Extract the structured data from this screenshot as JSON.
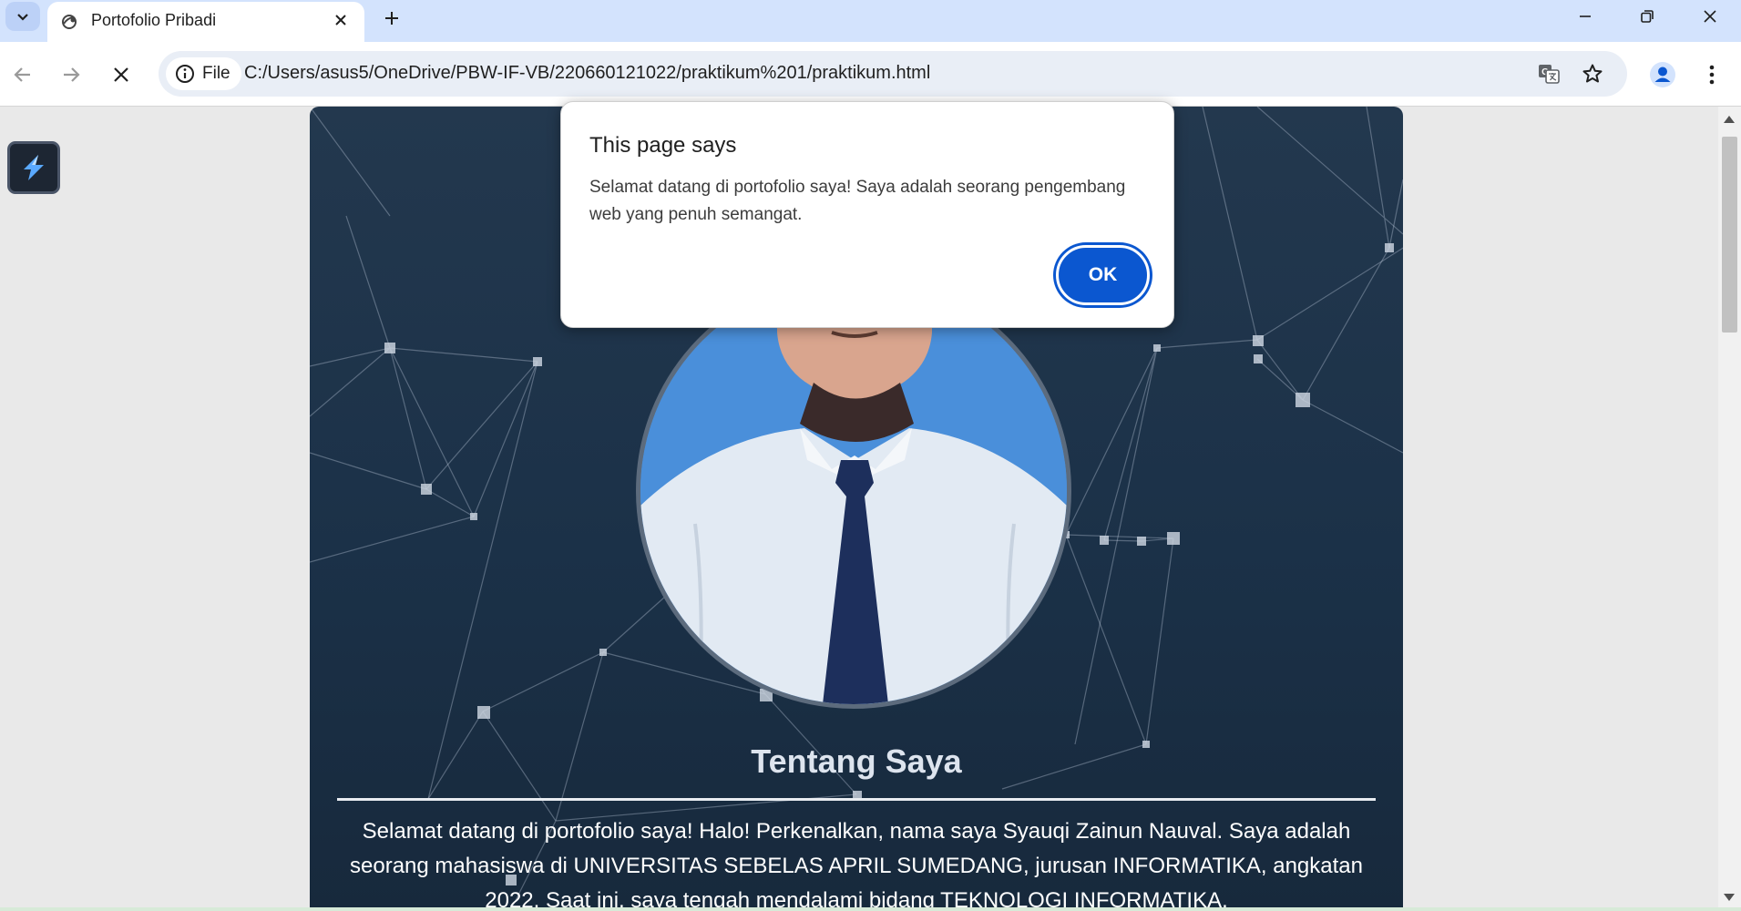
{
  "browser": {
    "tab": {
      "title": "Portofolio Pribadi"
    },
    "address_bar": {
      "chip_label": "File",
      "url": "C:/Users/asus5/OneDrive/PBW-IF-VB/220660121022/praktikum%201/praktikum.html"
    },
    "icons": {
      "tab_search": "chevron-down-icon",
      "favicon": "globe-icon",
      "close_tab": "close-icon",
      "new_tab": "plus-icon",
      "minimize": "minimize-icon",
      "restore": "restore-icon",
      "close_window": "close-icon",
      "back": "back-arrow-icon",
      "forward": "forward-arrow-icon",
      "stop": "stop-icon",
      "site_info": "info-icon",
      "translate": "translate-icon",
      "bookmark": "star-icon",
      "profile": "profile-icon",
      "menu": "kebab-menu-icon"
    }
  },
  "page": {
    "section_title": "Tentang Saya",
    "about_text": "Selamat datang di portofolio saya! Halo! Perkenalkan, nama saya Syauqi Zainun Nauval. Saya adalah seorang mahasiswa di UNIVERSITAS SEBELAS APRIL SUMEDANG, jurusan INFORMATIKA, angkatan 2022. Saat ini, saya tengah mendalami bidang TEKNOLOGI INFORMATIKA."
  },
  "dialog": {
    "title": "This page says",
    "message": "Selamat datang di portofolio saya! Saya adalah seorang pengembang web yang penuh semangat.",
    "ok_label": "OK"
  },
  "colors": {
    "tabstrip": "#d3e3fd",
    "page_background": "#1b3148",
    "ok_button": "#0b57d0"
  }
}
